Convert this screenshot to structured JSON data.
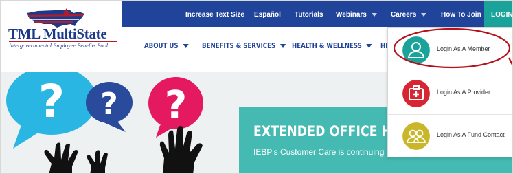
{
  "logo": {
    "title": "TML MultiState",
    "subtitle": "Intergovernmental Employee Benefits Pool",
    "colors": {
      "navy": "#1d3a8a",
      "red": "#b21d2b"
    }
  },
  "topbar": {
    "items": [
      {
        "label": "Increase Text Size",
        "has_caret": false
      },
      {
        "label": "Español",
        "has_caret": false
      },
      {
        "label": "Tutorials",
        "has_caret": false
      },
      {
        "label": "Webinars",
        "has_caret": true
      },
      {
        "label": "Careers",
        "has_caret": true
      },
      {
        "label": "How To Join",
        "has_caret": false
      }
    ],
    "login_label": "LOGIN",
    "background": "#21449b",
    "login_background": "#1aa39a"
  },
  "mainnav": {
    "items": [
      {
        "label": "ABOUT US"
      },
      {
        "label": "BENEFITS & SERVICES"
      },
      {
        "label": "HEALTH & WELLNESS"
      },
      {
        "label": "HE"
      }
    ]
  },
  "hero": {
    "title": "EXTENDED OFFICE HO",
    "text": "IEBP's Customer Care is continuing hours.",
    "panel_color": "#45bab3",
    "art_icons": [
      "question-bubble-icon",
      "question-bubble-icon",
      "question-bubble-icon",
      "raised-hand-icon"
    ]
  },
  "dropdown": {
    "items": [
      {
        "label": "Login As A Member",
        "icon": "member-icon",
        "icon_color": "#1aa39a"
      },
      {
        "label": "Login As A Provider",
        "icon": "medical-kit-icon",
        "icon_color": "#d82534"
      },
      {
        "label": "Login As A Fund Contact",
        "icon": "group-icon",
        "icon_color": "#c9b62a"
      }
    ]
  },
  "annotation": {
    "shape": "ellipse",
    "color": "#b5121b",
    "target": "Login As A Member"
  }
}
